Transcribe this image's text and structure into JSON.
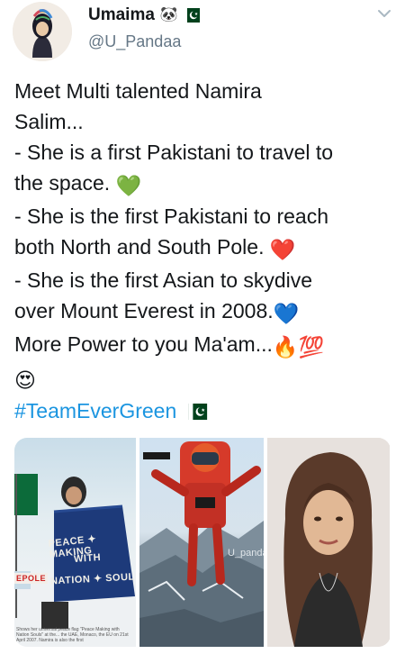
{
  "user": {
    "display_name": "Umaima",
    "name_emoji": "🐼",
    "handle": "@U_Pandaa"
  },
  "tweet": {
    "lines": [
      "Meet Multi talented Namira",
      "Salim...",
      "- She is a first Pakistani to travel to",
      "the space. ",
      "- She is the first Pakistani to reach",
      "both North and South Pole. ",
      "- She is the first Asian to skydive",
      "over Mount Everest in 2008.",
      "More Power to you Ma'am...",
      ""
    ],
    "emojis": {
      "green_heart": "💚",
      "red_heart": "❤️",
      "blue_heart": "💙",
      "fire": "🔥",
      "hundred": "💯",
      "heart_eyes": "😍"
    },
    "hashtag": "#TeamEverGreen"
  },
  "media": {
    "photo1_banner": [
      "PEACE ✦ MAKING",
      "WITH",
      "NATION ✦ SOUL"
    ],
    "photo1_tag": "EPOLE",
    "photo1_caption": "Shows her universal peace flag \"Peace Making with Nation Souls\" at the... the UAE, Monaco, the EU on 21st April 2007. Namira is also the first",
    "photo2_watermark": "U_pandaa"
  },
  "colors": {
    "text": "#14171a",
    "secondary": "#657786",
    "link": "#1b95e0",
    "flag_green": "#01411c"
  },
  "icons": [
    "panda-emoji",
    "pakistan-flag-icon",
    "chevron-down-icon"
  ]
}
